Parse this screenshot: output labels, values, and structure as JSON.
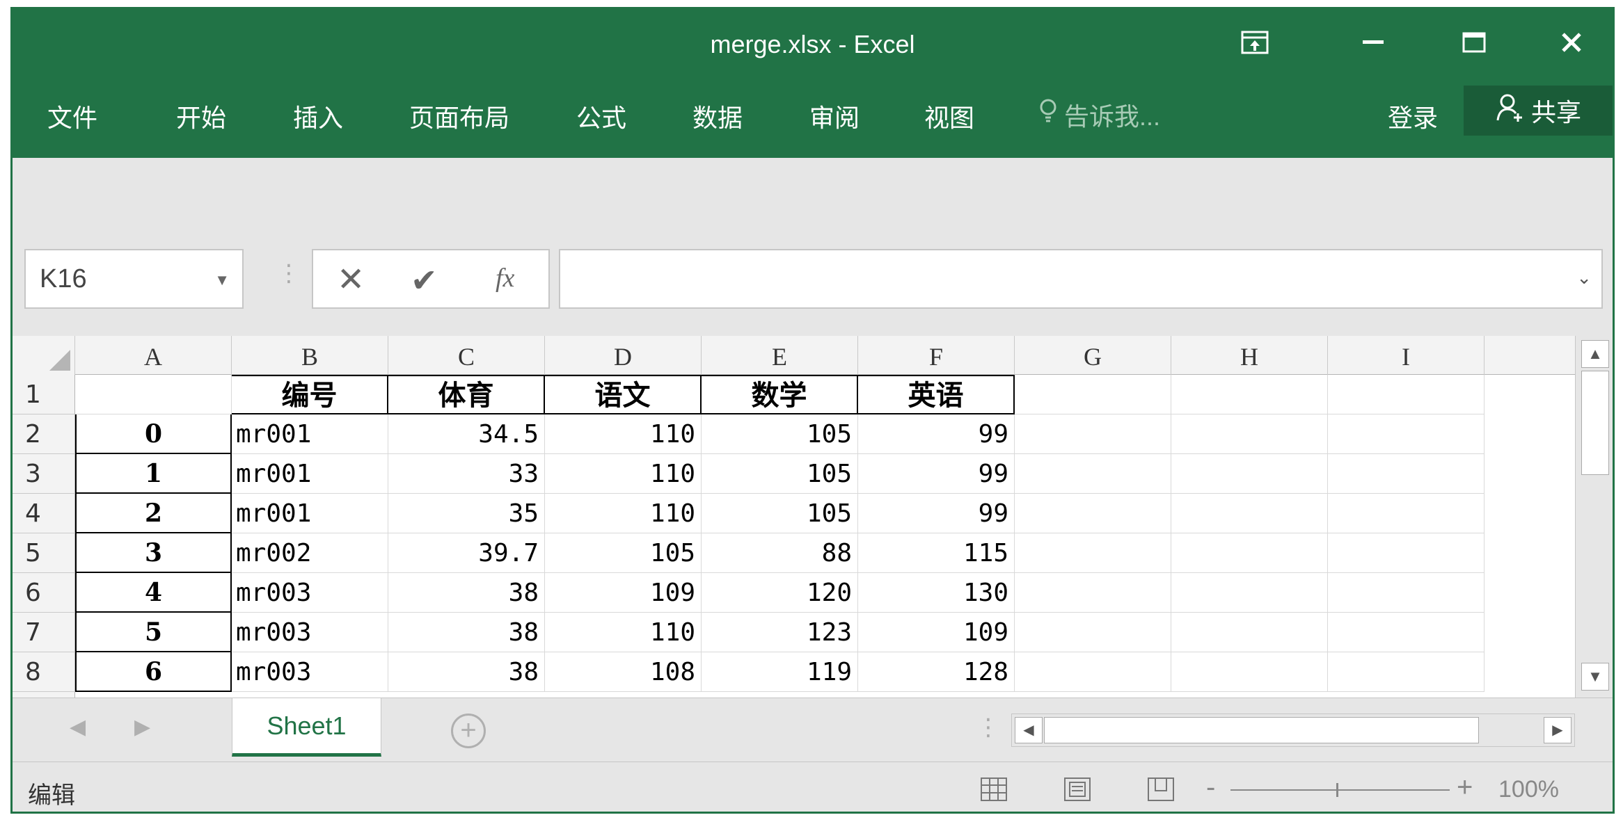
{
  "titlebar": {
    "title": "merge.xlsx - Excel"
  },
  "menu": {
    "items": [
      "文件",
      "开始",
      "插入",
      "页面布局",
      "公式",
      "数据",
      "审阅",
      "视图"
    ],
    "tell_me": "告诉我...",
    "login": "登录",
    "share": "共享"
  },
  "formula_bar": {
    "name_box": "K16",
    "formula": ""
  },
  "grid": {
    "columns": [
      "A",
      "B",
      "C",
      "D",
      "E",
      "F",
      "G",
      "H",
      "I"
    ],
    "rows": [
      "1",
      "2",
      "3",
      "4",
      "5",
      "6",
      "7",
      "8"
    ],
    "header": [
      "编号",
      "体育",
      "语文",
      "数学",
      "英语"
    ],
    "data": [
      {
        "idx": "0",
        "b": "mr001",
        "c": "34.5",
        "d": "110",
        "e": "105",
        "f": "99"
      },
      {
        "idx": "1",
        "b": "mr001",
        "c": "33",
        "d": "110",
        "e": "105",
        "f": "99"
      },
      {
        "idx": "2",
        "b": "mr001",
        "c": "35",
        "d": "110",
        "e": "105",
        "f": "99"
      },
      {
        "idx": "3",
        "b": "mr002",
        "c": "39.7",
        "d": "105",
        "e": "88",
        "f": "115"
      },
      {
        "idx": "4",
        "b": "mr003",
        "c": "38",
        "d": "109",
        "e": "120",
        "f": "130"
      },
      {
        "idx": "5",
        "b": "mr003",
        "c": "38",
        "d": "110",
        "e": "123",
        "f": "109"
      },
      {
        "idx": "6",
        "b": "mr003",
        "c": "38",
        "d": "108",
        "e": "119",
        "f": "128"
      }
    ]
  },
  "sheets": {
    "active": "Sheet1"
  },
  "status": {
    "mode": "编辑",
    "zoom": "100%"
  },
  "colors": {
    "accent": "#217346",
    "share_bg": "#1a5c38"
  }
}
